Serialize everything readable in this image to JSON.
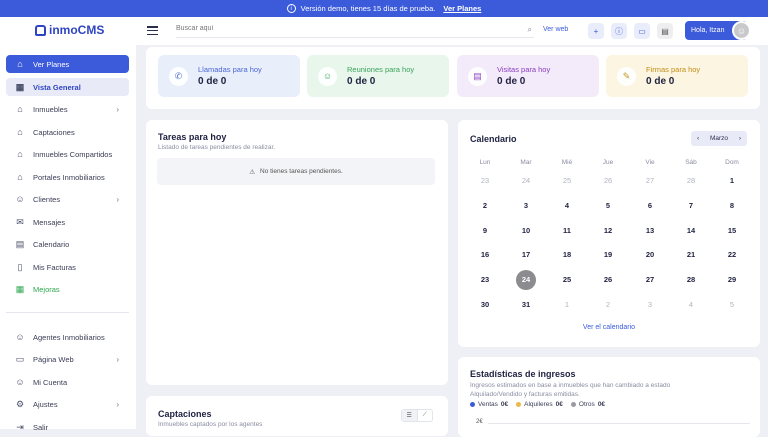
{
  "banner": {
    "text": "Versión demo, tienes 15 días de prueba.",
    "link": "Ver Planes"
  },
  "app": {
    "name": "inmoCMS"
  },
  "sidebar": {
    "items": [
      {
        "label": "Ver Planes",
        "icon": "tag-icon"
      },
      {
        "label": "Vista General",
        "icon": "dashboard-icon"
      },
      {
        "label": "Inmuebles",
        "icon": "home-icon"
      },
      {
        "label": "Captaciones",
        "icon": "house-plus-icon"
      },
      {
        "label": "Inmuebles Compartidos",
        "icon": "shared-house-icon"
      },
      {
        "label": "Portales Inmobiliarios",
        "icon": "portal-icon"
      },
      {
        "label": "Clientes",
        "icon": "user-icon"
      },
      {
        "label": "Mensajes",
        "icon": "message-icon"
      },
      {
        "label": "Calendario",
        "icon": "calendar-icon"
      },
      {
        "label": "Mis Facturas",
        "icon": "invoice-icon"
      },
      {
        "label": "Mejoras",
        "icon": "grid-icon"
      },
      {
        "label": "Agentes Inmobiliarios",
        "icon": "agents-icon"
      },
      {
        "label": "Página Web",
        "icon": "web-icon"
      },
      {
        "label": "Mi Cuenta",
        "icon": "account-icon"
      },
      {
        "label": "Ajustes",
        "icon": "gear-icon"
      },
      {
        "label": "Salir",
        "icon": "logout-icon"
      }
    ]
  },
  "topbar": {
    "search_placeholder": "Buscar aquí",
    "ver_web": "Ver web",
    "user_greeting": "Hola, Itzan"
  },
  "stats": [
    {
      "label": "Llamadas para hoy",
      "value": "0 de 0",
      "color": "#4a67d6",
      "bg": "#e9eefb"
    },
    {
      "label": "Reuniones para hoy",
      "value": "0 de 0",
      "color": "#3aa35a",
      "bg": "#e9f6ec"
    },
    {
      "label": "Visitas para hoy",
      "value": "0 de 0",
      "color": "#8a3fbf",
      "bg": "#f3eafa"
    },
    {
      "label": "Firmas para hoy",
      "value": "0 de 0",
      "color": "#c48f16",
      "bg": "#fbf5e1"
    }
  ],
  "tasks": {
    "title": "Tareas para hoy",
    "subtitle": "Listado de tareas pendientes de realizar.",
    "empty": "No tienes tareas pendientes."
  },
  "calendar": {
    "title": "Calendario",
    "month": "Marzo",
    "weekdays": [
      "Lun",
      "Mar",
      "Mié",
      "Jue",
      "Vie",
      "Sáb",
      "Dom"
    ],
    "rows": [
      [
        [
          "23",
          true
        ],
        [
          "24",
          true
        ],
        [
          "25",
          true
        ],
        [
          "26",
          true
        ],
        [
          "27",
          true
        ],
        [
          "28",
          true
        ],
        [
          "1",
          false
        ]
      ],
      [
        [
          "2",
          false
        ],
        [
          "3",
          false
        ],
        [
          "4",
          false
        ],
        [
          "5",
          false
        ],
        [
          "6",
          false
        ],
        [
          "7",
          false
        ],
        [
          "8",
          false
        ]
      ],
      [
        [
          "9",
          false
        ],
        [
          "10",
          false
        ],
        [
          "11",
          false
        ],
        [
          "12",
          false
        ],
        [
          "13",
          false
        ],
        [
          "14",
          false
        ],
        [
          "15",
          false
        ]
      ],
      [
        [
          "16",
          false
        ],
        [
          "17",
          false
        ],
        [
          "18",
          false
        ],
        [
          "19",
          false
        ],
        [
          "20",
          false
        ],
        [
          "21",
          false
        ],
        [
          "22",
          false
        ]
      ],
      [
        [
          "23",
          false
        ],
        [
          "24",
          false
        ],
        [
          "25",
          false
        ],
        [
          "26",
          false
        ],
        [
          "27",
          false
        ],
        [
          "28",
          false
        ],
        [
          "29",
          false
        ]
      ],
      [
        [
          "30",
          false
        ],
        [
          "31",
          false
        ],
        [
          "1",
          true
        ],
        [
          "2",
          true
        ],
        [
          "3",
          true
        ],
        [
          "4",
          true
        ],
        [
          "5",
          true
        ]
      ]
    ],
    "today": "24",
    "link": "Ver el calendario"
  },
  "captaciones": {
    "title": "Captaciones",
    "subtitle": "Inmuebles captados por los agentes"
  },
  "ingresos": {
    "title": "Estadísticas de ingresos",
    "subtitle": "Ingresos estimados en base a inmuebles que han cambiado a estado Alquilado/Vendido y facturas emitidas.",
    "legend": [
      {
        "name": "Ventas",
        "value": "0€",
        "color": "#3b5bdb"
      },
      {
        "name": "Alquileres",
        "value": "0€",
        "color": "#e9b949"
      },
      {
        "name": "Otros",
        "value": "0€",
        "color": "#9a9aa0"
      }
    ],
    "axis_label": "2€"
  }
}
